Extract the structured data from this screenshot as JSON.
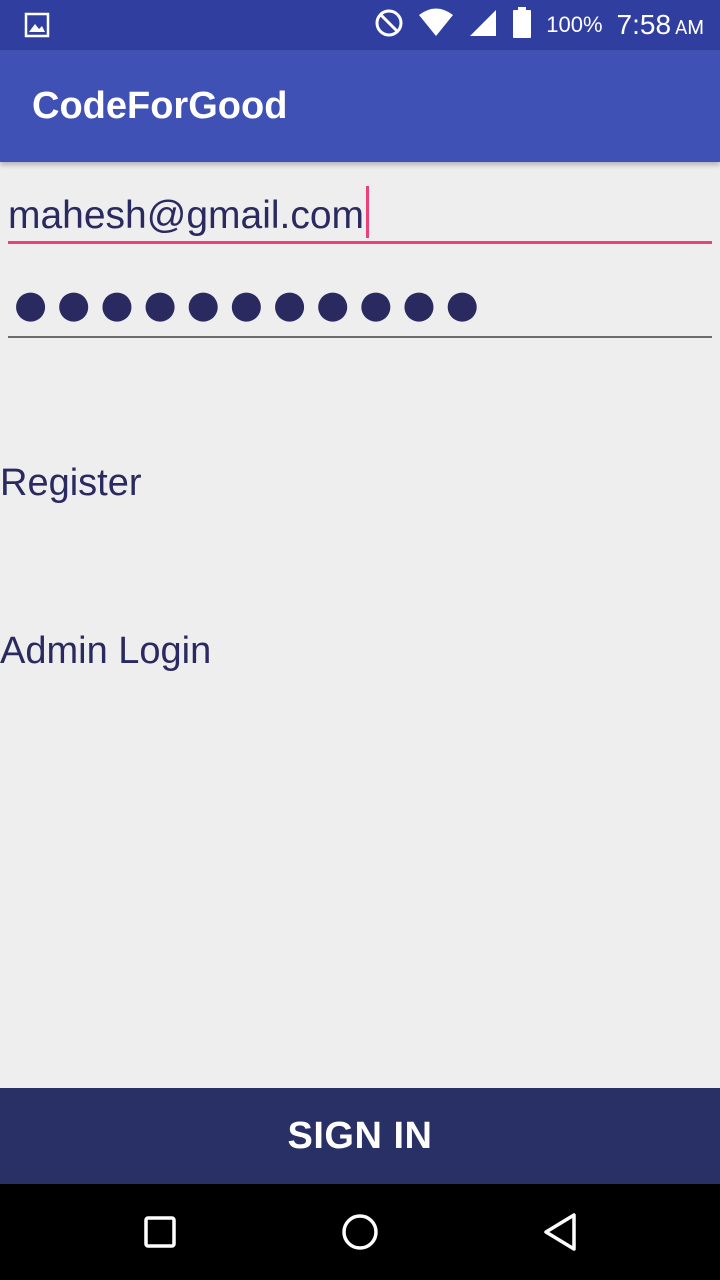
{
  "status_bar": {
    "battery_percent": "100%",
    "time": "7:58",
    "am_pm": "AM",
    "icons": [
      "image-notification-icon",
      "do-not-disturb-icon",
      "wifi-icon",
      "cell-signal-icon",
      "battery-icon"
    ]
  },
  "app_bar": {
    "title": "CodeForGood"
  },
  "login_form": {
    "email_value": "mahesh@gmail.com",
    "password_masked": "●●●●●●●●●●●"
  },
  "links": {
    "register": "Register",
    "admin_login": "Admin Login"
  },
  "actions": {
    "sign_in_label": "SIGN IN"
  },
  "nav_bar": {
    "icons": [
      "recent-apps-icon",
      "home-icon",
      "back-icon"
    ]
  },
  "colors": {
    "status_bar": "#303f9f",
    "app_bar": "#3f51b5",
    "accent": "#ec407a",
    "sign_in_button": "#283066",
    "text": "#2a2a60"
  }
}
